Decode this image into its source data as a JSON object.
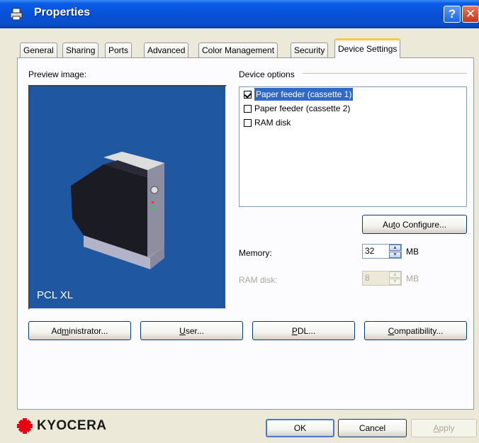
{
  "window": {
    "title": "Properties",
    "help_label": "?",
    "close_label": "✕"
  },
  "tabs": [
    {
      "label": "General"
    },
    {
      "label": "Sharing"
    },
    {
      "label": "Ports"
    },
    {
      "label": "Advanced"
    },
    {
      "label": "Color Management"
    },
    {
      "label": "Security"
    },
    {
      "label": "Device Settings",
      "active": true
    }
  ],
  "preview": {
    "label": "Preview image:",
    "caption": "PCL XL"
  },
  "device_options": {
    "label": "Device options",
    "items": [
      {
        "label": "Paper feeder (cassette 1)",
        "checked": true,
        "selected": true
      },
      {
        "label": "Paper feeder (cassette 2)",
        "checked": false,
        "selected": false
      },
      {
        "label": "RAM disk",
        "checked": false,
        "selected": false
      }
    ]
  },
  "auto_configure": {
    "pre": "Au",
    "u": "t",
    "post": "o Configure..."
  },
  "memory": {
    "label": "Memory:",
    "value": "32",
    "unit": "MB"
  },
  "ram_disk": {
    "label": "RAM disk:",
    "value": "8",
    "unit": "MB"
  },
  "buttons": {
    "administrator": {
      "pre": "Ad",
      "u": "m",
      "post": "inistrator..."
    },
    "user": {
      "pre": "",
      "u": "U",
      "post": "ser..."
    },
    "pdl": {
      "pre": "",
      "u": "P",
      "post": "DL..."
    },
    "compatibility": {
      "pre": "",
      "u": "C",
      "post": "ompatibility..."
    }
  },
  "footer": {
    "brand": "KYOCERA",
    "ok": "OK",
    "cancel": "Cancel",
    "apply_pre": "",
    "apply_u": "A",
    "apply_post": "pply"
  },
  "colors": {
    "title_bar": "#0851d6",
    "preview_bg": "#1f58a0",
    "selection": "#316ac5",
    "active_tab_accent": "#ffc83c",
    "brand_red": "#e60012"
  }
}
